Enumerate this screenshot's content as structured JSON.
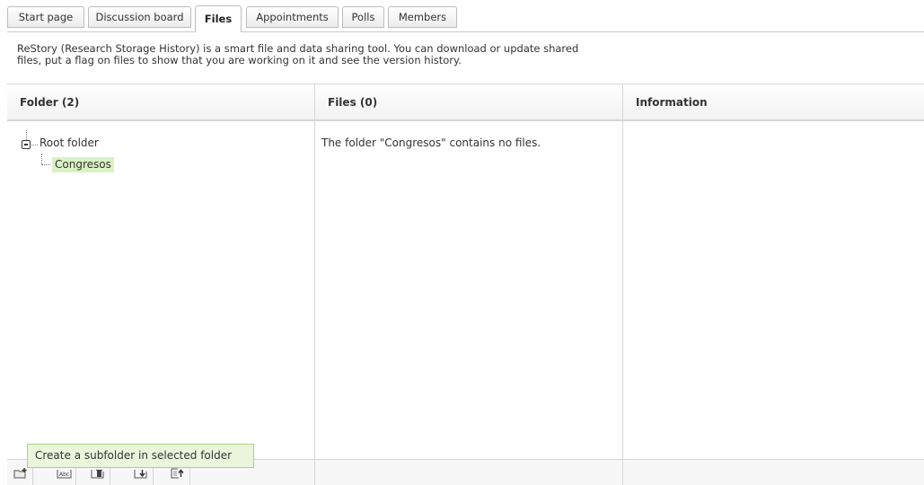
{
  "tabs": [
    {
      "label": "Start page"
    },
    {
      "label": "Discussion board"
    },
    {
      "label": "Files",
      "active": true
    },
    {
      "label": "Appointments"
    },
    {
      "label": "Polls"
    },
    {
      "label": "Members"
    }
  ],
  "description": {
    "line1": "ReStory (Research Storage History) is a smart file and data sharing tool. You can download or update shared",
    "line2": "files, put a flag on files to show that you are working on it and see the version history."
  },
  "columns": {
    "folder": {
      "header": "Folder (2)"
    },
    "files": {
      "header": "Files (0)",
      "message": "The folder \"Congresos\" contains no files."
    },
    "info": {
      "header": "Information"
    }
  },
  "tree": {
    "root": {
      "label": "Root folder",
      "expanded": true,
      "toggle_icon": "collapse-minus-icon"
    },
    "children": [
      {
        "label": "Congresos",
        "selected": true
      }
    ]
  },
  "toolbar": {
    "buttons": [
      {
        "icon": "new-subfolder-icon"
      },
      {
        "icon": "rename-folder-icon"
      },
      {
        "icon": "delete-folder-icon"
      },
      {
        "icon": "download-folder-icon"
      },
      {
        "icon": "upload-file-icon"
      }
    ]
  },
  "tooltip": {
    "text": "Create a subfolder in selected folder"
  },
  "colors": {
    "selected_highlight": "#d9f2c4",
    "tooltip_bg": "#e9f6dc",
    "tooltip_border": "#a6d47f",
    "border": "#d6d6d6"
  }
}
